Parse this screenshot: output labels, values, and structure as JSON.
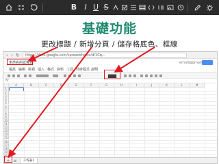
{
  "toolbar": {
    "buttons": [
      {
        "icon": "home-icon"
      },
      {
        "icon": "exit-fullscreen-icon"
      },
      {
        "icon": "undo-icon"
      },
      {
        "label": "B",
        "icon": "bold-icon"
      },
      {
        "label": "I",
        "icon": "italic-icon"
      },
      {
        "label": "U",
        "icon": "underline-icon"
      },
      {
        "label": "S",
        "icon": "strikethrough-icon"
      },
      {
        "icon": "heading-icon"
      },
      {
        "icon": "checkbox-icon"
      },
      {
        "icon": "list-icon"
      },
      {
        "icon": "numbered-list-icon"
      },
      {
        "icon": "code-icon"
      },
      {
        "icon": "quote-icon"
      },
      {
        "icon": "image-icon"
      },
      {
        "icon": "clock-icon"
      },
      {
        "icon": "pen-icon"
      },
      {
        "icon": "settings-icon"
      }
    ]
  },
  "slide": {
    "title": "基礎功能",
    "caption": "更改標題 / 新增分頁 / 儲存格底色、框線"
  },
  "screenshot": {
    "url": "https://docs.google.com/spreadsheets/d/1Cq...",
    "account": "email@gmail.com",
    "doc_title": "未命名的試算表",
    "menu": [
      "檔案",
      "編輯",
      "檢視",
      "插入",
      "格式",
      "資料",
      "工具",
      "外掛程式",
      "說明"
    ],
    "columns": [
      "A",
      "B",
      "C",
      "D",
      "E",
      "F",
      "G",
      "H",
      "I",
      "J",
      "K",
      "L",
      "M"
    ],
    "rows": [
      "1",
      "2",
      "3",
      "4",
      "5",
      "6",
      "7",
      "8",
      "9",
      "10",
      "11",
      "12",
      "13",
      "14",
      "15",
      "16",
      "17",
      "18",
      "19",
      "20"
    ],
    "sheet_tab": "工作表1",
    "add_sheet_glyph": "+",
    "sheet_list_glyph": "≡"
  },
  "colors": {
    "title_green": "#1d8a6f",
    "callout_red": "#e0191f",
    "toolbar_bg": "#2b2b2b"
  }
}
